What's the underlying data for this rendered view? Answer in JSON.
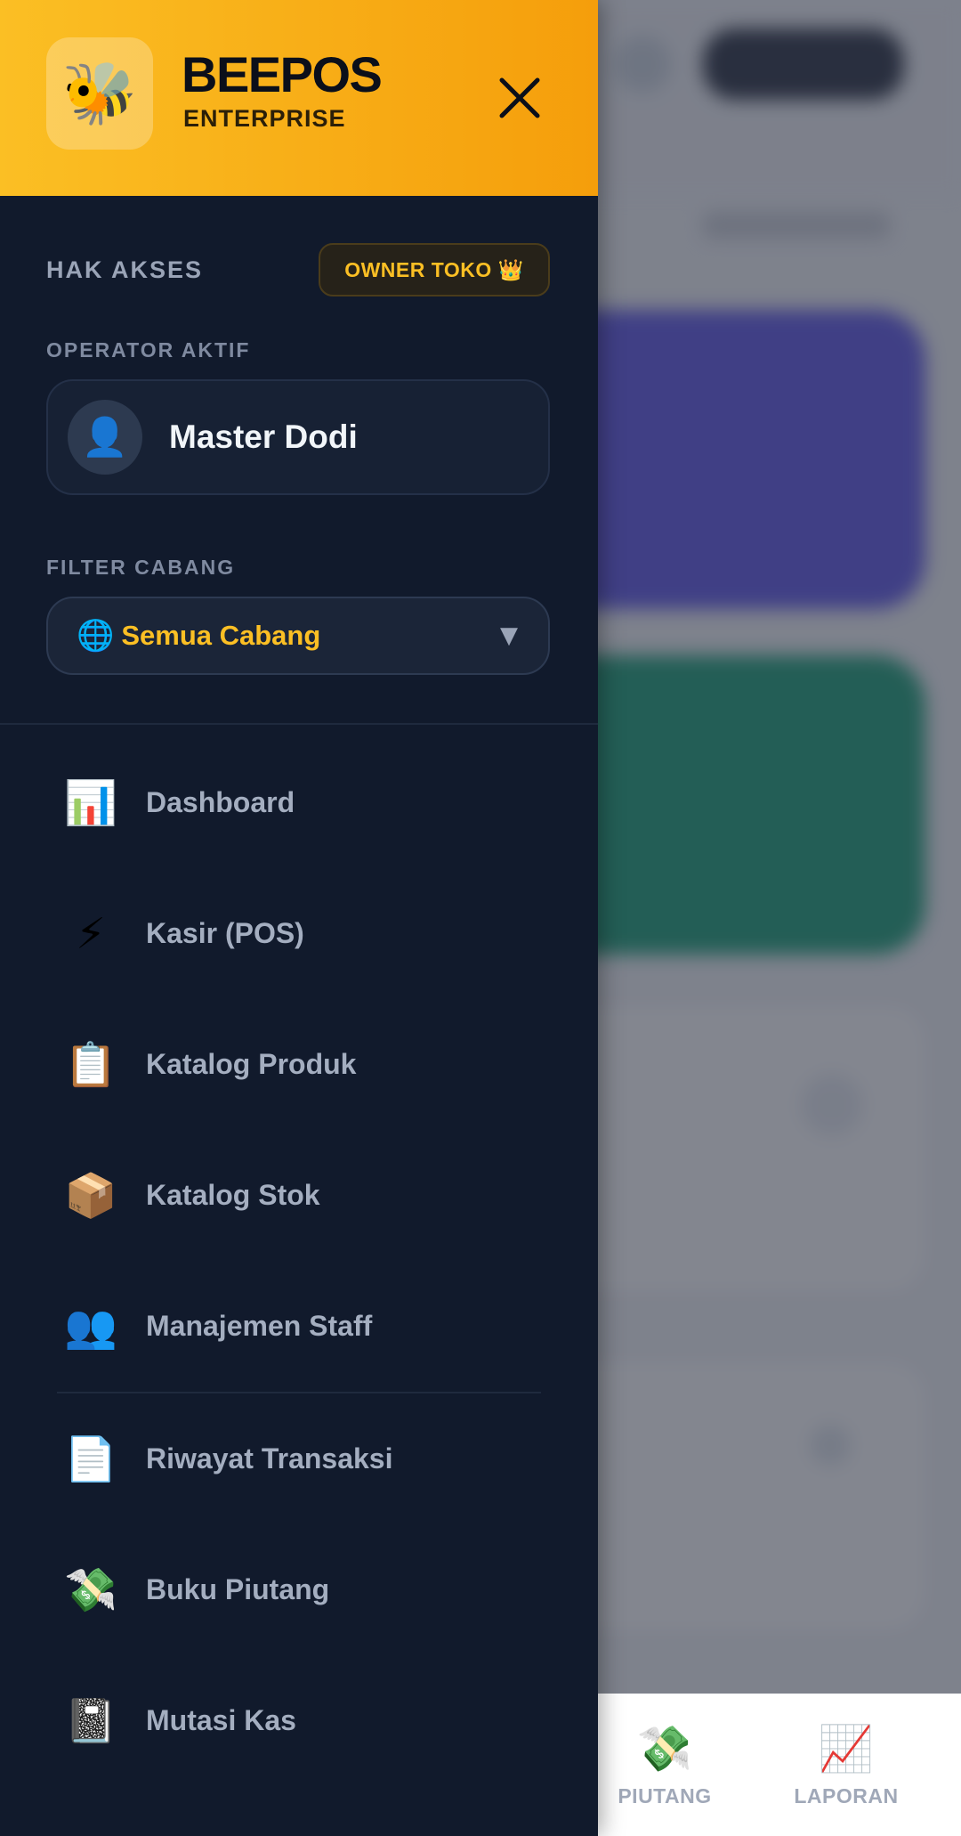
{
  "brand": {
    "logo_icon": "bee-icon",
    "logo_glyph": "🐝",
    "title": "BEEPOS",
    "subtitle": "ENTERPRISE",
    "close_icon": "close-icon"
  },
  "access": {
    "label": "HAK AKSES",
    "role_badge": "OWNER TOKO 👑"
  },
  "operator": {
    "label": "OPERATOR AKTIF",
    "avatar_glyph": "👤",
    "name": "Master Dodi"
  },
  "branch_filter": {
    "label": "FILTER CABANG",
    "icon_glyph": "🌐",
    "selected": "Semua Cabang",
    "chevron": "▼"
  },
  "menu": {
    "items": [
      {
        "icon": "📊",
        "icon_name": "chart-icon",
        "label": "Dashboard"
      },
      {
        "icon": "⚡",
        "icon_name": "lightning-icon",
        "label": "Kasir (POS)"
      },
      {
        "icon": "📋",
        "icon_name": "clipboard-icon",
        "label": "Katalog Produk"
      },
      {
        "icon": "📦",
        "icon_name": "box-icon",
        "label": "Katalog Stok"
      },
      {
        "icon": "👥",
        "icon_name": "users-icon",
        "label": "Manajemen Staff"
      },
      {
        "icon": "📄",
        "icon_name": "document-icon",
        "label": "Riwayat Transaksi"
      },
      {
        "icon": "💸",
        "icon_name": "money-wings-icon",
        "label": "Buku Piutang"
      },
      {
        "icon": "📓",
        "icon_name": "notebook-icon",
        "label": "Mutasi Kas"
      }
    ]
  },
  "bottom_nav": {
    "items": [
      {
        "icon": "💸",
        "icon_name": "money-wings-icon",
        "label": "PIUTANG"
      },
      {
        "icon": "📈",
        "icon_name": "chart-up-icon",
        "label": "LAPORAN"
      }
    ]
  },
  "colors": {
    "accent": "#fbbf24",
    "drawer_bg": "#111a2c",
    "header_gradient_end": "#f59e0b"
  }
}
